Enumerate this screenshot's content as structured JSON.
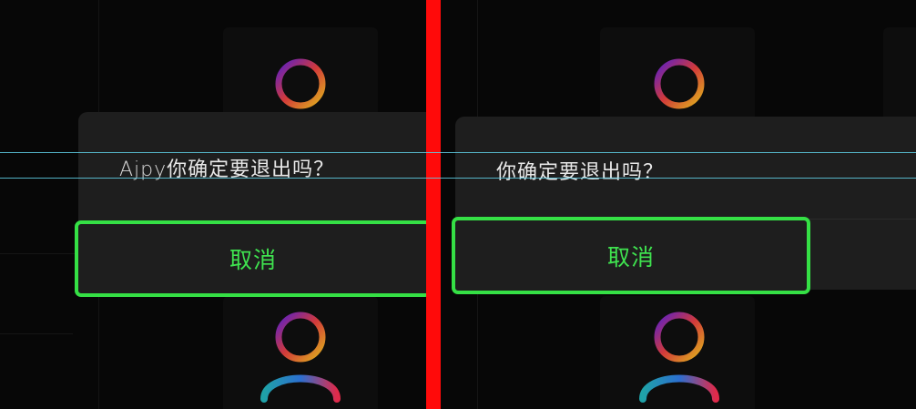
{
  "colors": {
    "divider": "#ff0a0a",
    "dialog_bg": "#1e1e1e",
    "button_border": "#35e045",
    "button_text": "#3fe24f",
    "guide_line": "#5fd0e6"
  },
  "left_panel": {
    "dialog": {
      "prefix": "Ajpy",
      "message": "你确定要退出吗？",
      "cancel_label": "取消"
    }
  },
  "right_panel": {
    "dialog": {
      "message": "你确定要退出吗？",
      "cancel_label": "取消"
    }
  },
  "icons": {
    "avatar": "user-avatar-icon",
    "separator": "vertical-divider"
  }
}
